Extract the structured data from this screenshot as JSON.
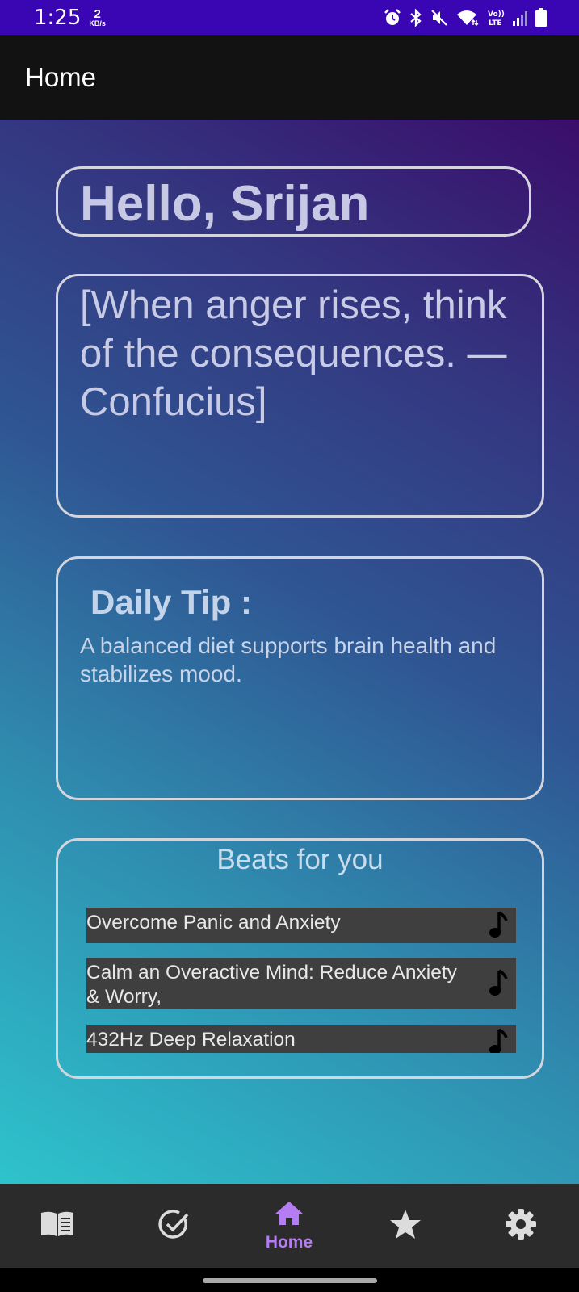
{
  "status_bar": {
    "time": "1:25",
    "net_speed_value": "2",
    "net_speed_unit": "KB/s",
    "icons": [
      "alarm-icon",
      "bluetooth-icon",
      "mute-icon",
      "wifi-icon",
      "volte-icon",
      "signal-icon",
      "battery-icon"
    ],
    "volte_label": "Vo)) LTE"
  },
  "app_bar": {
    "title": "Home"
  },
  "greeting": {
    "text": "Hello, Srijan"
  },
  "quote": {
    "text": "[When anger rises, think of the consequences. — Confucius]"
  },
  "daily_tip": {
    "title": "Daily Tip :",
    "text": "A balanced diet supports brain health and stabilizes mood."
  },
  "beats": {
    "title": "Beats for you",
    "items": [
      {
        "label": "Overcome Panic and Anxiety",
        "icon": "music-note-icon"
      },
      {
        "label": "Calm an Overactive Mind: Reduce Anxiety & Worry,",
        "icon": "music-note-icon"
      },
      {
        "label": "432Hz Deep Relaxation",
        "icon": "music-note-icon"
      }
    ]
  },
  "bottom_nav": {
    "items": [
      {
        "icon": "book-icon",
        "label": ""
      },
      {
        "icon": "check-circle-icon",
        "label": ""
      },
      {
        "icon": "home-icon",
        "label": "Home",
        "selected": true
      },
      {
        "icon": "star-icon",
        "label": ""
      },
      {
        "icon": "gear-icon",
        "label": ""
      }
    ],
    "selected_color": "#b57cf4",
    "icon_color": "#dcdcdc"
  },
  "colors": {
    "status_bar": "#3a06b3",
    "app_bar": "#121212",
    "card_border": "#d4d4dc",
    "beat_item_bg": "#3f3f3f"
  }
}
